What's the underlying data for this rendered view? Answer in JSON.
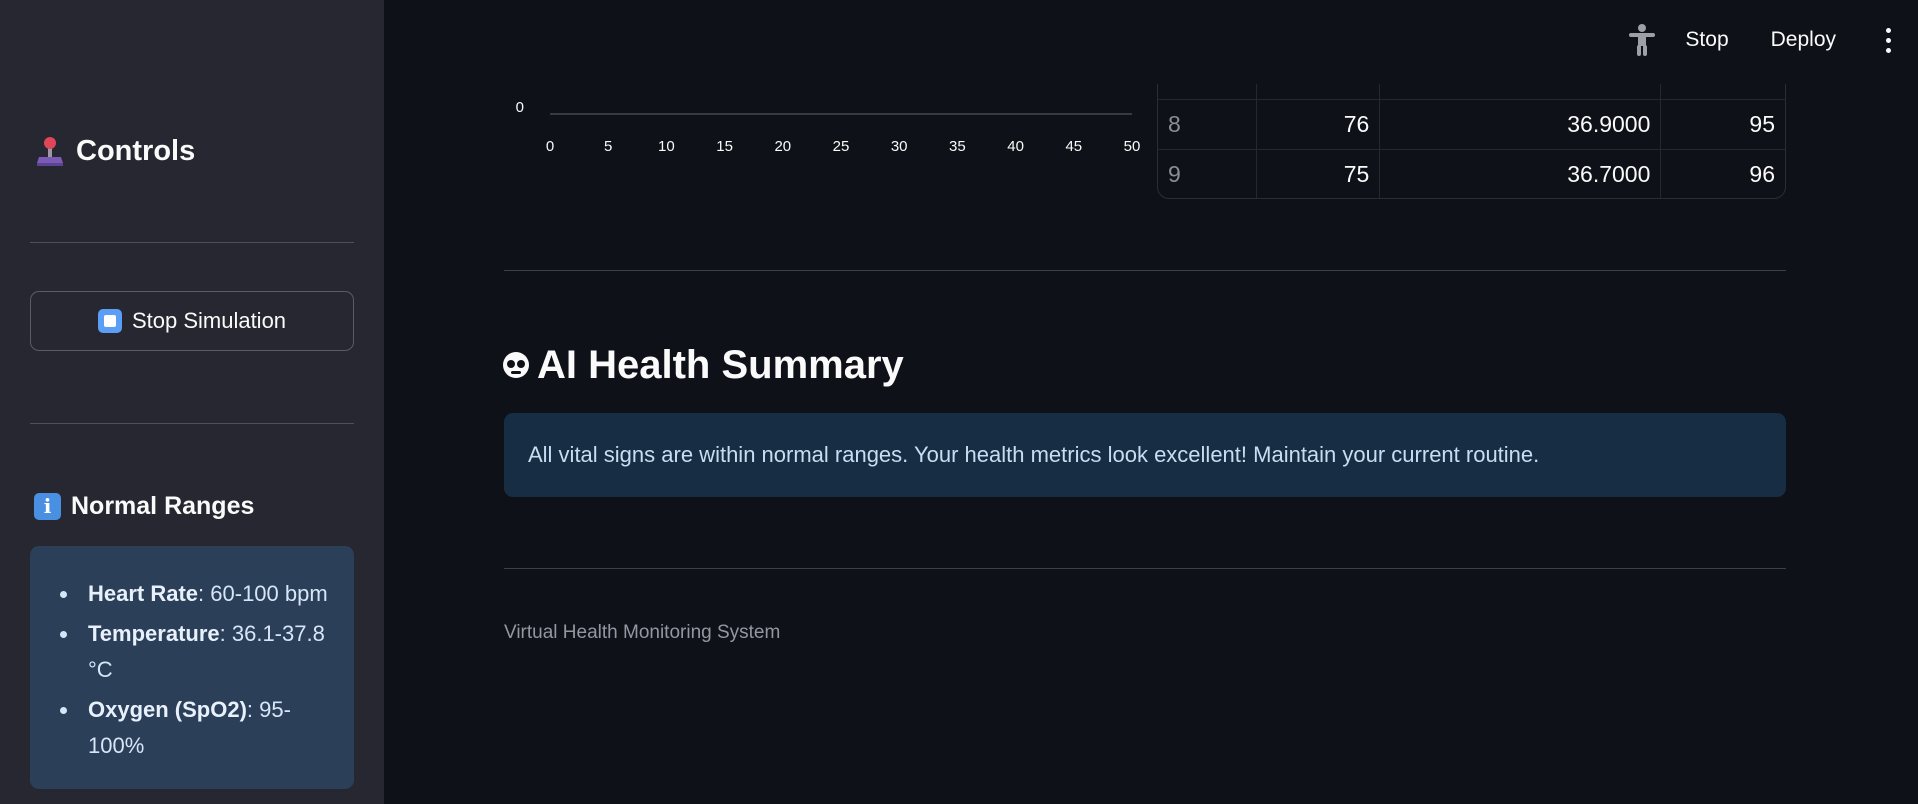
{
  "sidebar": {
    "title": "Controls",
    "title_icon": "joystick-icon",
    "stop_button_label": "Stop Simulation",
    "stop_button_icon": "stop-square-icon",
    "ranges_title": "Normal Ranges",
    "ranges_icon": "info-icon",
    "ranges": [
      {
        "label": "Heart Rate",
        "value": ": 60-100 bpm"
      },
      {
        "label": "Temperature",
        "value": ": 36.1-37.8 °C"
      },
      {
        "label": "Oxygen (SpO2)",
        "value": ": 95-100%"
      }
    ]
  },
  "header": {
    "accessibility_icon": "accessibility-icon",
    "stop_label": "Stop",
    "deploy_label": "Deploy",
    "menu_icon": "kebab-menu-icon"
  },
  "chart_data": {
    "type": "line",
    "x_ticks": [
      "0",
      "5",
      "10",
      "15",
      "20",
      "25",
      "30",
      "35",
      "40",
      "45",
      "50"
    ],
    "y_ticks_visible": [
      "0"
    ],
    "xlim": [
      0,
      50
    ]
  },
  "table": {
    "rows": [
      [
        "8",
        "76",
        "36.9000",
        "95"
      ],
      [
        "9",
        "75",
        "36.7000",
        "96"
      ]
    ]
  },
  "main": {
    "ai_title": "AI Health Summary",
    "ai_icon": "robot-face-icon",
    "summary_text": "All vital signs are within normal ranges. Your health metrics look excellent! Maintain your current routine.",
    "footer": "Virtual Health Monitoring System"
  },
  "colors": {
    "background": "#0e1117",
    "sidebar": "#262730",
    "info_box": "#2b3f59",
    "summary_box": "#172d43"
  }
}
